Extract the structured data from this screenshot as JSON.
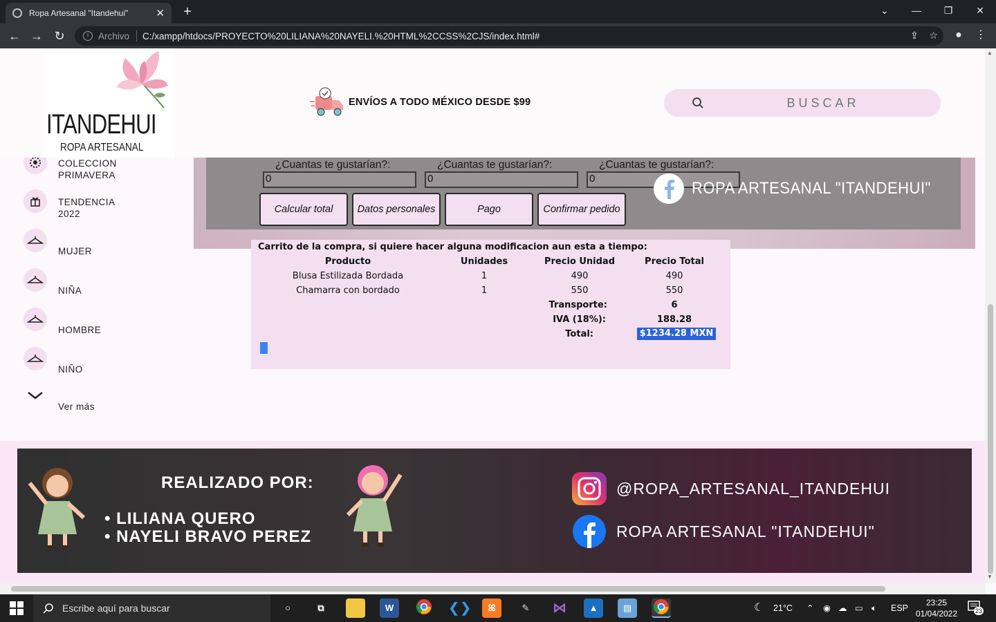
{
  "browser": {
    "tab_title": "Ropa Artesanal \"Itandehui\"",
    "url_scheme": "Archivo",
    "url": "C:/xampp/htdocs/PROYECTO%20LILIANA%20NAYELI.%20HTML%2CCSS%2CJS/index.html#"
  },
  "header": {
    "logo_main": "ITANDEHUI",
    "logo_sub": "ROPA ARTESANAL",
    "shipping": "ENVÍOS A TODO MÉXICO DESDE $99",
    "search_placeholder": "BUSCAR"
  },
  "sidebar": {
    "items": [
      {
        "label": "COLECCION\nPRIMAVERA",
        "icon": "leaf-icon"
      },
      {
        "label": "TENDENCIA\n2022",
        "icon": "gift-icon"
      },
      {
        "label": "MUJER",
        "icon": "hanger-icon"
      },
      {
        "label": "NIÑA",
        "icon": "hanger-icon"
      },
      {
        "label": "HOMBRE",
        "icon": "hanger-icon"
      },
      {
        "label": "NIÑO",
        "icon": "hanger-icon"
      }
    ],
    "more": "Ver más"
  },
  "products": {
    "qty_label": "¿Cuantas te gustarían?:",
    "qty_values": [
      "0",
      "0",
      "0"
    ],
    "buttons": [
      "Calcular total",
      "Datos personales",
      "Pago",
      "Confirmar pedido"
    ],
    "facebook_text": "ROPA ARTESANAL \"ITANDEHUI\""
  },
  "cart": {
    "title": "Carrito de la compra, si quiere hacer alguna modificacion aun esta a tiempo:",
    "headers": [
      "Producto",
      "Unidades",
      "Precio Unidad",
      "Precio Total"
    ],
    "rows": [
      {
        "product": "Blusa Estilizada Bordada",
        "units": "1",
        "unit_price": "490",
        "total": "490"
      },
      {
        "product": "Chamarra con bordado",
        "units": "1",
        "unit_price": "550",
        "total": "550"
      }
    ],
    "transport_label": "Transporte:",
    "transport_value": "6",
    "iva_label": "IVA (18%):",
    "iva_value": "188.28",
    "total_label": "Total:",
    "total_value": "$1234.28 MXN"
  },
  "footer": {
    "made_by": "REALIZADO POR:",
    "authors": [
      "• LILIANA QUERO",
      "• NAYELI BRAVO PEREZ"
    ],
    "instagram": "@ROPA_ARTESANAL_ITANDEHUI",
    "facebook": "ROPA ARTESANAL \"ITANDEHUI\""
  },
  "taskbar": {
    "search_placeholder": "Escribe aquí para buscar",
    "weather": "21°C",
    "language": "ESP",
    "time": "23:25",
    "date": "01/04/2022",
    "notifications": "23"
  },
  "colors": {
    "accent_pink": "#f3dff0",
    "selection_blue": "#2a62d8",
    "chrome_dark": "#202124"
  }
}
